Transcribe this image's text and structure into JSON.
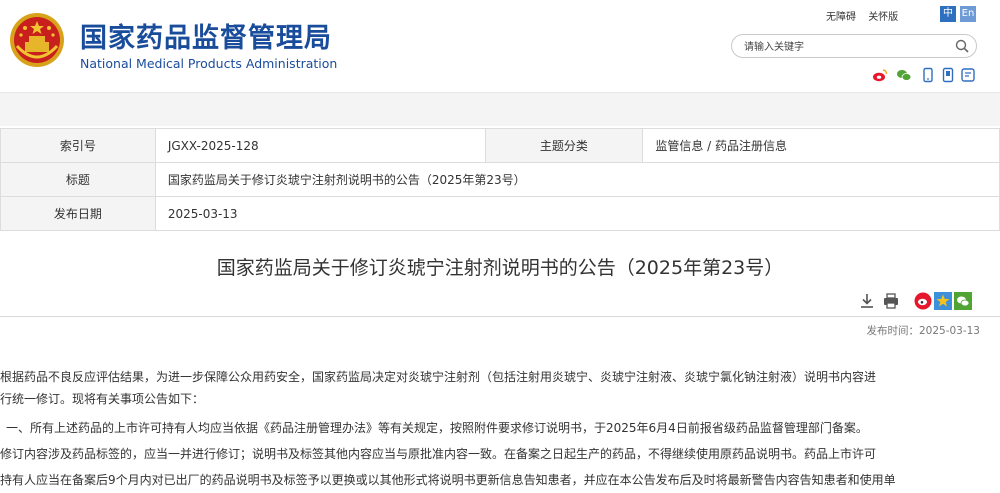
{
  "header": {
    "title_cn": "国家药品监督管理局",
    "title_en": "National Medical Products Administration",
    "toplinks": [
      "无障碍",
      "关怀版"
    ],
    "lang": [
      "中",
      "En"
    ],
    "search_placeholder": "请输入关键字"
  },
  "meta": {
    "index_label": "索引号",
    "index_value": "JGXX-2025-128",
    "category_label": "主题分类",
    "category_value": "监管信息 / 药品注册信息",
    "title_label": "标题",
    "title_value": "国家药监局关于修订炎琥宁注射剂说明书的公告（2025年第23号）",
    "date_label": "发布日期",
    "date_value": "2025-03-13"
  },
  "article": {
    "title": "国家药监局关于修订炎琥宁注射剂说明书的公告（2025年第23号）",
    "publish_time": "发布时间：2025-03-13",
    "paragraphs": [
      "根据药品不良反应评估结果，为进一步保障公众用药安全，国家药监局决定对炎琥宁注射剂（包括注射用炎琥宁、炎琥宁注射液、炎琥宁氯化钠注射液）说明书内容进",
      "行统一修订。现将有关事项公告如下：",
      "一、所有上述药品的上市许可持有人均应当依据《药品注册管理办法》等有关规定，按照附件要求修订说明书，于2025年6月4日前报省级药品监督管理部门备案。",
      "修订内容涉及药品标签的，应当一并进行修订；说明书及标签其他内容应当与原批准内容一致。在备案之日起生产的药品，不得继续使用原药品说明书。药品上市许可",
      "持有人应当在备案后9个月内对已出厂的药品说明书及标签予以更换或以其他形式将说明书更新信息告知患者，并应在本公告发布后及时将最新警告内容告知患者和使用单"
    ]
  }
}
